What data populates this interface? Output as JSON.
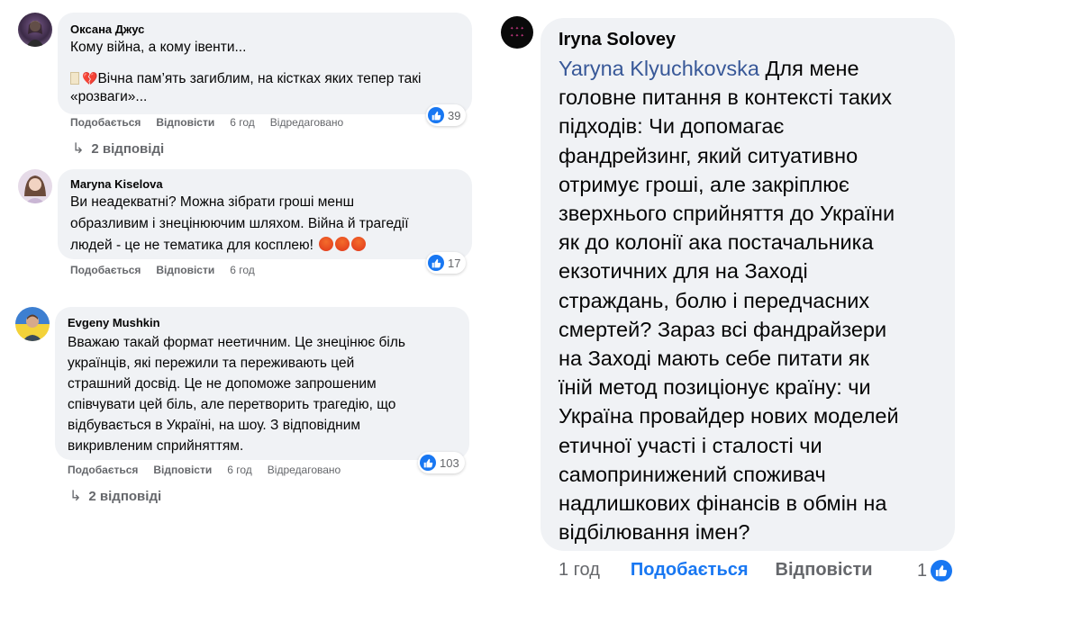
{
  "comments": [
    {
      "author": "Оксана Джус",
      "line1": "Кому війна, а кому івенти...",
      "line2": "Вічна пам’ять загиблим, на кістках яких тепер такі",
      "line3": "«розваги»...",
      "like_label": "Подобається",
      "reply_label": "Відповісти",
      "time": "6 год",
      "edited": "Відредаговано",
      "reactions": "39",
      "replies": "2 відповіді"
    },
    {
      "author": "Maryna Kiselova",
      "line1": "Ви неадекватні? Можна зібрати гроші менш",
      "line2": "образливим і знецінюючим шляхом. Війна й трагедії",
      "line3": "людей - це не тематика для косплею!",
      "like_label": "Подобається",
      "reply_label": "Відповісти",
      "time": "6 год",
      "reactions": "17"
    },
    {
      "author": "Evgeny Mushkin",
      "lines": [
        "Вважаю такай формат неетичним. Це знецінює біль",
        "українців, які пережили та переживають цей",
        "страшний досвід. Це не допоможе запрошеним",
        "співчувати цей біль, але перетворить трагедію, що",
        "відбувається в Україні, на шоу. З відповідним",
        "викривленим сприйняттям."
      ],
      "like_label": "Подобається",
      "reply_label": "Відповісти",
      "time": "6 год",
      "edited": "Відредаговано",
      "reactions": "103",
      "replies": "2 відповіді"
    }
  ],
  "main_comment": {
    "author": "Iryna Solovey",
    "mention": "Yaryna Klyuchkovska",
    "lines": [
      "Для мене",
      "головне питання в контексті таких",
      "підходів: Чи допомагає",
      "фандрейзинг, який ситуативно",
      "отримує гроші, але закріплює",
      "зверхнього сприйняття до України",
      "як до колонії ака постачальника",
      "екзотичних для на Заході",
      "страждань, болю і передчасних",
      "смертей? Зараз всі фандрайзери",
      "на Заході мають себе питати як",
      "їній метод позиціонує країну: чи",
      "Україна провайдер нових моделей",
      "етичної участі і сталості чи",
      "самопринижений споживач",
      "надлишкових фінансів в обмін на",
      "відбілювання імен?"
    ],
    "time": "1 год",
    "like_label": "Подобається",
    "reply_label": "Відповісти",
    "reactions": "1"
  },
  "colors": {
    "bubble": "#f0f2f5",
    "like_blue": "#1877f2",
    "mention": "#385898",
    "meta_gray": "#65676b"
  }
}
